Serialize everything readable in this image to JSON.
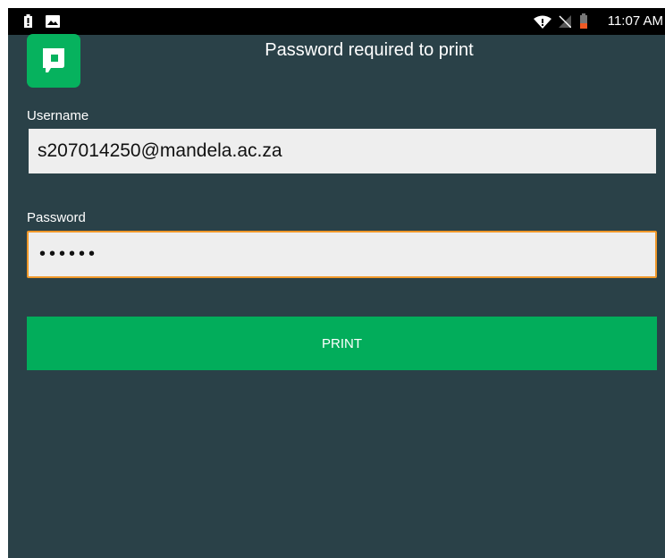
{
  "status_bar": {
    "clock": "11:07 AM",
    "icons": [
      "battery-alert-icon",
      "image-notification-icon",
      "wifi-icon",
      "no-signal-icon",
      "battery-icon"
    ]
  },
  "app": {
    "logo_icon": "papercut-logo-icon",
    "title": "Password required to print"
  },
  "form": {
    "username_label": "Username",
    "username_value": "s207014250@mandela.ac.za",
    "password_label": "Password",
    "password_value": "••••••"
  },
  "actions": {
    "print_label": "PRINT"
  },
  "colors": {
    "background": "#2a4148",
    "accent": "#02ad5b",
    "focus_border": "#f0982a",
    "input_fill": "#eeeeee"
  }
}
